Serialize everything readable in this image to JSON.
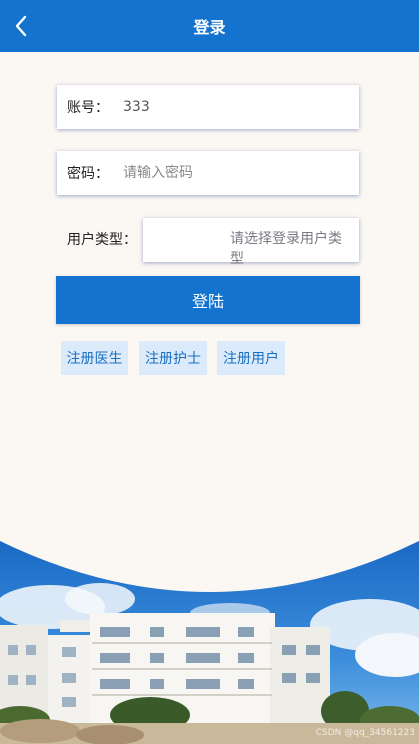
{
  "header": {
    "title": "登录"
  },
  "form": {
    "account_label": "账号：",
    "account_value": "333",
    "password_label": "密码：",
    "password_placeholder": "请输入密码",
    "user_type_label": "用户类型：",
    "user_type_placeholder": "请选择登录用户类型"
  },
  "login_button": "登陆",
  "register_buttons": [
    "注册医生",
    "注册护士",
    "注册用户"
  ],
  "watermark": "CSDN @qq_34561223",
  "colors": {
    "primary": "#1473cf",
    "register_bg": "#dcebfb",
    "page_bg": "#fbf7f3"
  },
  "icons": {
    "back": "chevron-left-icon"
  }
}
